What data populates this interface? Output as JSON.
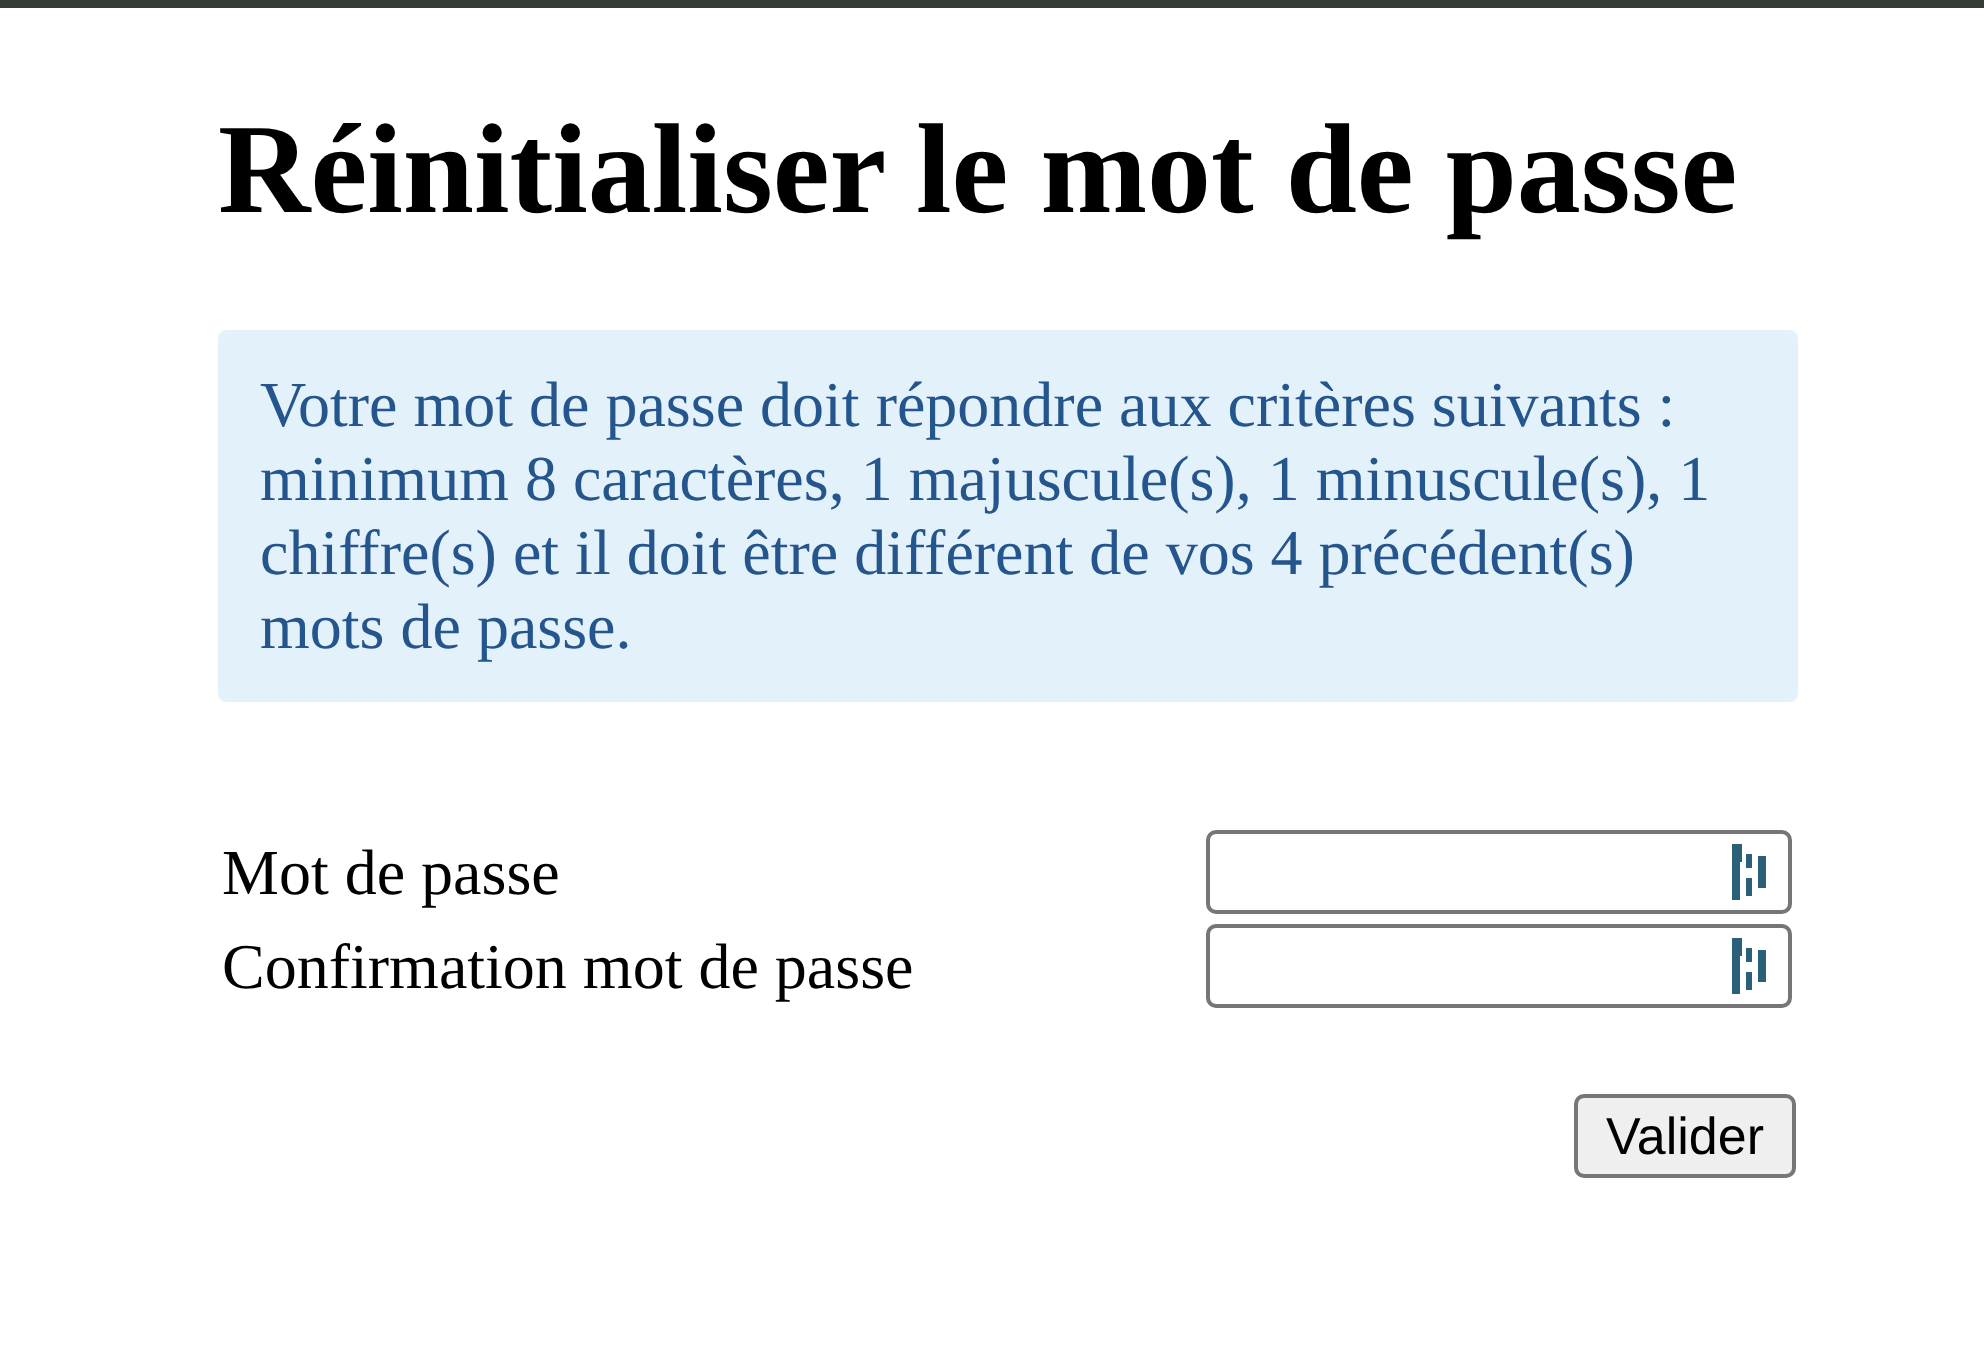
{
  "title": "Réinitialiser le mot de passe",
  "info": "Votre mot de passe doit répondre aux critères suivants : minimum 8 caractères, 1 majuscule(s), 1 minuscule(s), 1 chiffre(s) et il doit être différent de vos 4 précédent(s) mots de passe.",
  "fields": [
    {
      "label": "Mot de passe"
    },
    {
      "label": "Confirmation mot de passe"
    }
  ],
  "submit": "Valider"
}
